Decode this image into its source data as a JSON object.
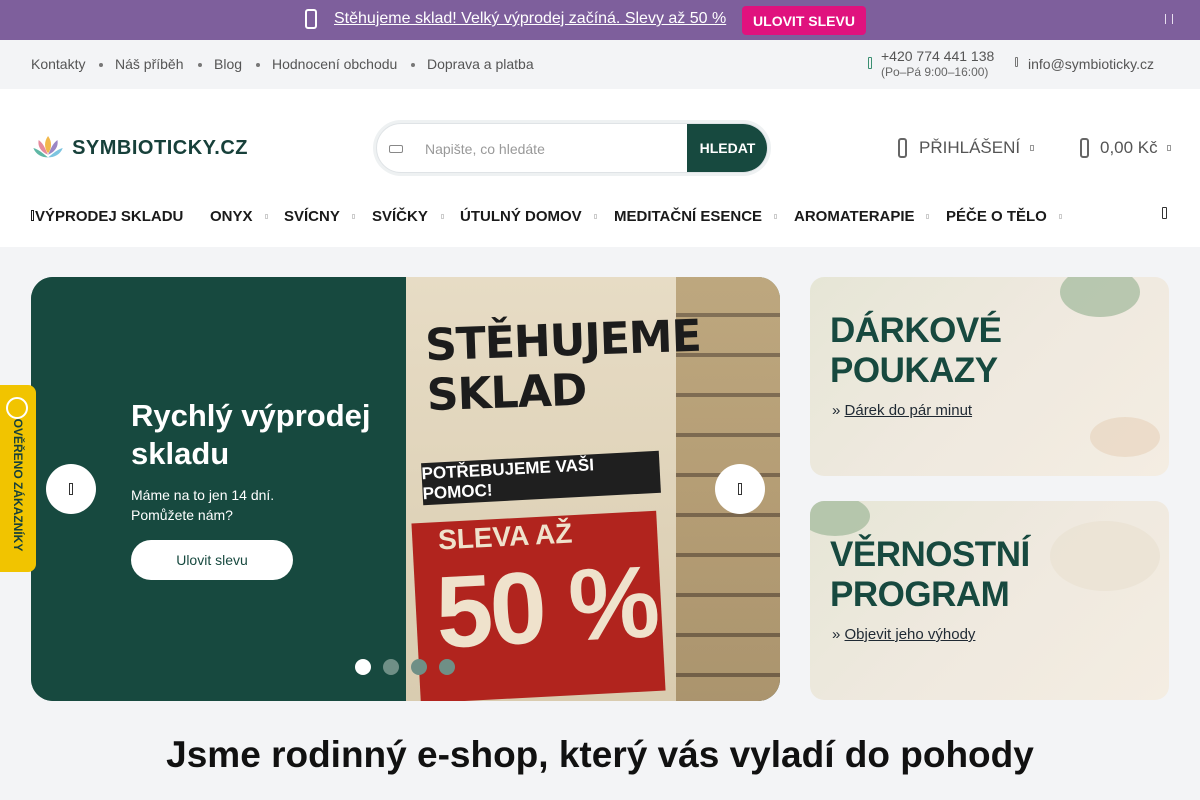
{
  "announcement": {
    "text": "Stěhujeme sklad! Velký výprodej začíná. Slevy až 50 %",
    "button": "ULOVIT SLEVU"
  },
  "topbar": {
    "links": [
      "Kontakty",
      "Náš příběh",
      "Blog",
      "Hodnocení obchodu",
      "Doprava a platba"
    ],
    "phone": "+420 774 441 138",
    "hours": "(Po–Pá 9:00–16:00)",
    "email": "info@symbioticky.cz"
  },
  "header": {
    "logo_text": "SYMBIOTICKY.CZ",
    "search_placeholder": "Napište, co hledáte",
    "search_button": "HLEDAT",
    "login": "PŘIHLÁŠENÍ",
    "cart_total": "0,00 Kč"
  },
  "nav": [
    "VÝPRODEJ SKLADU",
    "ONYX",
    "SVÍCNY",
    "SVÍČKY",
    "ÚTULNÝ DOMOV",
    "MEDITAČNÍ ESENCE",
    "AROMATERAPIE",
    "PÉČE O TĚLO"
  ],
  "hero": {
    "title": "Rychlý výprodej skladu",
    "desc": "Máme na to jen 14 dní. Pomůžete nám?",
    "button": "Ulovit slevu",
    "poster_line1": "STĚHUJEME SKLAD",
    "poster_line2": "POTŘEBUJEME VAŠI POMOC!",
    "poster_line3": "SLEVA AŽ",
    "poster_line4": "50 %",
    "slides": 4,
    "active_slide": 1
  },
  "promos": [
    {
      "title": "DÁRKOVÉ POUKAZY",
      "link": "Dárek do pár minut"
    },
    {
      "title": "VĚRNOSTNÍ PROGRAM",
      "link": "Objevit jeho výhody"
    }
  ],
  "verified": {
    "label": "OVĚŘENO ZÁKAZNÍKY"
  },
  "tagline": "Jsme rodinný e-shop, který vás vyladí do pohody",
  "colors": {
    "announce_bg": "#7e5f9c",
    "accent_pink": "#e0127e",
    "brand_green": "#17493f",
    "badge_yellow": "#f1c400"
  }
}
